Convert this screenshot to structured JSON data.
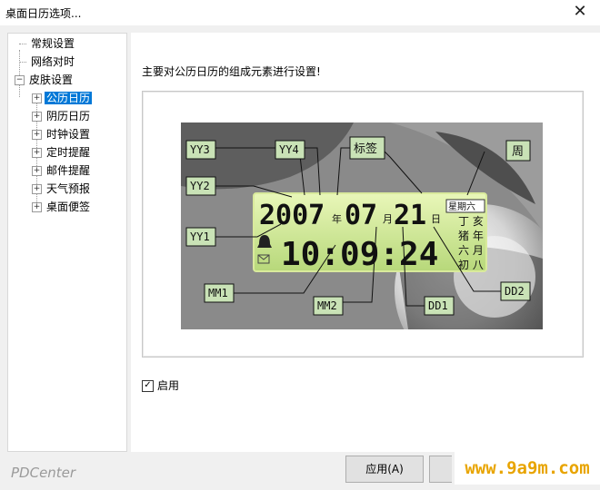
{
  "window": {
    "title": "桌面日历选项...",
    "close_label": "✕"
  },
  "tree": {
    "items": [
      {
        "label": "常规设置"
      },
      {
        "label": "网络对时"
      },
      {
        "label": "皮肤设置"
      },
      {
        "label": "公历日历"
      },
      {
        "label": "阴历日历"
      },
      {
        "label": "时钟设置"
      },
      {
        "label": "定时提醒"
      },
      {
        "label": "邮件提醒"
      },
      {
        "label": "天气预报"
      },
      {
        "label": "桌面便签"
      }
    ]
  },
  "panel": {
    "description": "主要对公历日历的组成元素进行设置!",
    "enable_label": "启用",
    "enable_checked": "✓"
  },
  "preview": {
    "date_digits": "2007",
    "year_char": "年",
    "month_digits": "07",
    "month_char": "月",
    "day_digits": "21",
    "day_char": "日",
    "weekday": "星期六",
    "lunar_line1": "丁 亥",
    "lunar_line2": "猪 年",
    "lunar_line3": "六 月",
    "lunar_line4": "初 八",
    "time": "10:09:24",
    "callouts": {
      "yy3": "YY3",
      "yy4": "YY4",
      "biaoqian": "标签",
      "zhou": "周",
      "yy2": "YY2",
      "yy1": "YY1",
      "mm1": "MM1",
      "mm2": "MM2",
      "dd1": "DD1",
      "dd2": "DD2"
    }
  },
  "footer": {
    "brand": "PDCenter",
    "apply_label": "应用(A)",
    "watermark": "www.9a9m.com"
  }
}
